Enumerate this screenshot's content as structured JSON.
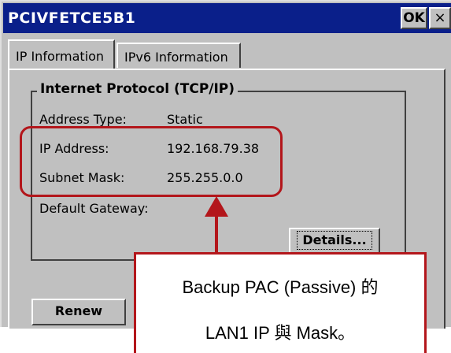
{
  "window": {
    "title": "PCIVFETCE5B1",
    "ok_label": "OK",
    "close_label": "×"
  },
  "tabs": [
    {
      "label": "IP Information",
      "active": true
    },
    {
      "label": "IPv6 Information",
      "active": false
    }
  ],
  "group": {
    "title": "Internet Protocol (TCP/IP)",
    "fields": [
      {
        "label": "Address Type:",
        "value": "Static"
      },
      {
        "label": "IP Address:",
        "value": "192.168.79.38"
      },
      {
        "label": "Subnet Mask:",
        "value": "255.255.0.0"
      },
      {
        "label": "Default Gateway:",
        "value": ""
      }
    ]
  },
  "buttons": {
    "details_label": "Details...",
    "renew_label": "Renew"
  },
  "annotation": {
    "line1": "Backup PAC (Passive) 的",
    "line2": "LAN1 IP 與 Mask。",
    "color": "#b3161b"
  },
  "colors": {
    "titlebar": "#0a1f8a",
    "face": "#c0c0c0"
  }
}
